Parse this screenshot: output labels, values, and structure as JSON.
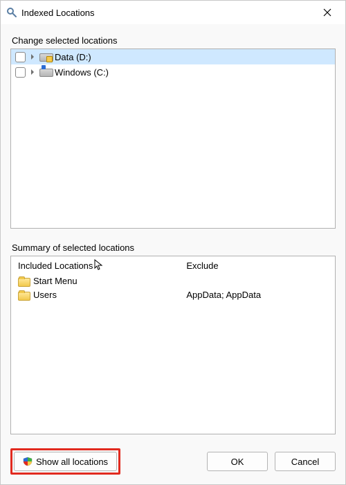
{
  "window": {
    "title": "Indexed Locations"
  },
  "change": {
    "label": "Change selected locations",
    "items": [
      {
        "label": "Data (D:)",
        "checked": false,
        "selected": true,
        "kind": "data"
      },
      {
        "label": "Windows (C:)",
        "checked": false,
        "selected": false,
        "kind": "win"
      }
    ]
  },
  "summary": {
    "label": "Summary of selected locations",
    "included_header": "Included Locations",
    "exclude_header": "Exclude",
    "included": [
      {
        "label": "Start Menu"
      },
      {
        "label": "Users"
      }
    ],
    "exclude": [
      "",
      "AppData; AppData"
    ]
  },
  "buttons": {
    "show_all": "Show all locations",
    "ok": "OK",
    "cancel": "Cancel"
  }
}
